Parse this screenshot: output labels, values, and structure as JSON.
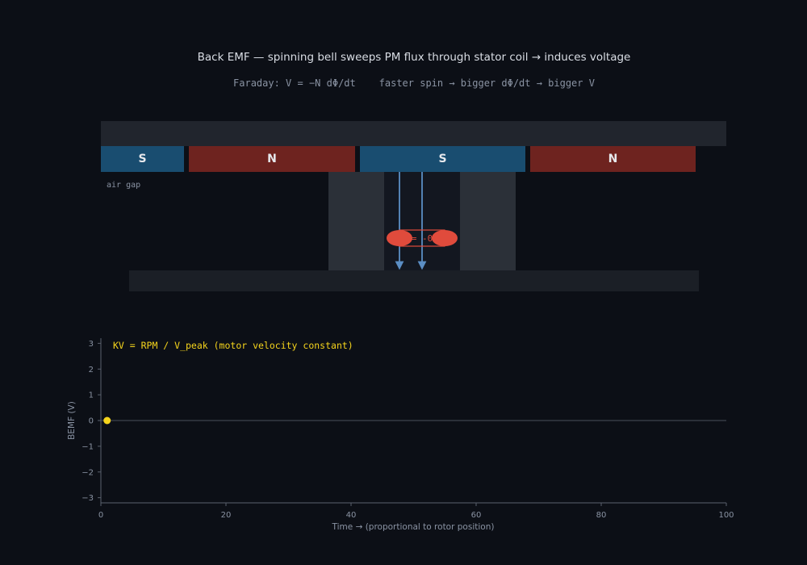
{
  "header": {
    "title": "Back EMF — spinning bell sweeps PM flux through stator coil → induces voltage",
    "subtitle": "Faraday: V = −N dΦ/dt    faster spin → bigger dΦ/dt → bigger V"
  },
  "magnets": [
    {
      "pole": "S",
      "color": "#194d70"
    },
    {
      "pole": "N",
      "color": "#6e231f"
    },
    {
      "pole": "S",
      "color": "#194d70"
    },
    {
      "pole": "N",
      "color": "#6e231f"
    }
  ],
  "air_gap_label": "air gap",
  "coil_label": "= -0",
  "colors": {
    "background": "#0c0f16",
    "rotor_back_iron": "#21252d",
    "stator_base": "#1b1f26",
    "stator_tooth": "#2b3038",
    "coil": "#e04b3c",
    "flux_arrow": "#5b8ec4",
    "marker": "#f5d41c",
    "annotation": "#f5d41c"
  },
  "chart_data": {
    "type": "line",
    "title": "",
    "xlabel": "Time →  (proportional to rotor position)",
    "ylabel": "BEMF  (V)",
    "xlim": [
      0,
      100
    ],
    "ylim": [
      -3.2,
      3.2
    ],
    "xticks": [
      "0",
      "20",
      "40",
      "60",
      "80",
      "100"
    ],
    "yticks": [
      "3",
      "2",
      "1",
      "0",
      "−1",
      "−2",
      "−3"
    ],
    "xtick_values": [
      0,
      20,
      40,
      60,
      80,
      100
    ],
    "ytick_values": [
      3,
      2,
      1,
      0,
      -1,
      -2,
      -3
    ],
    "grid": false,
    "zero_line": true,
    "annotation": "KV = RPM / V_peak  (motor velocity constant)",
    "series": [
      {
        "x": [
          1
        ],
        "y": [
          0
        ]
      }
    ]
  }
}
